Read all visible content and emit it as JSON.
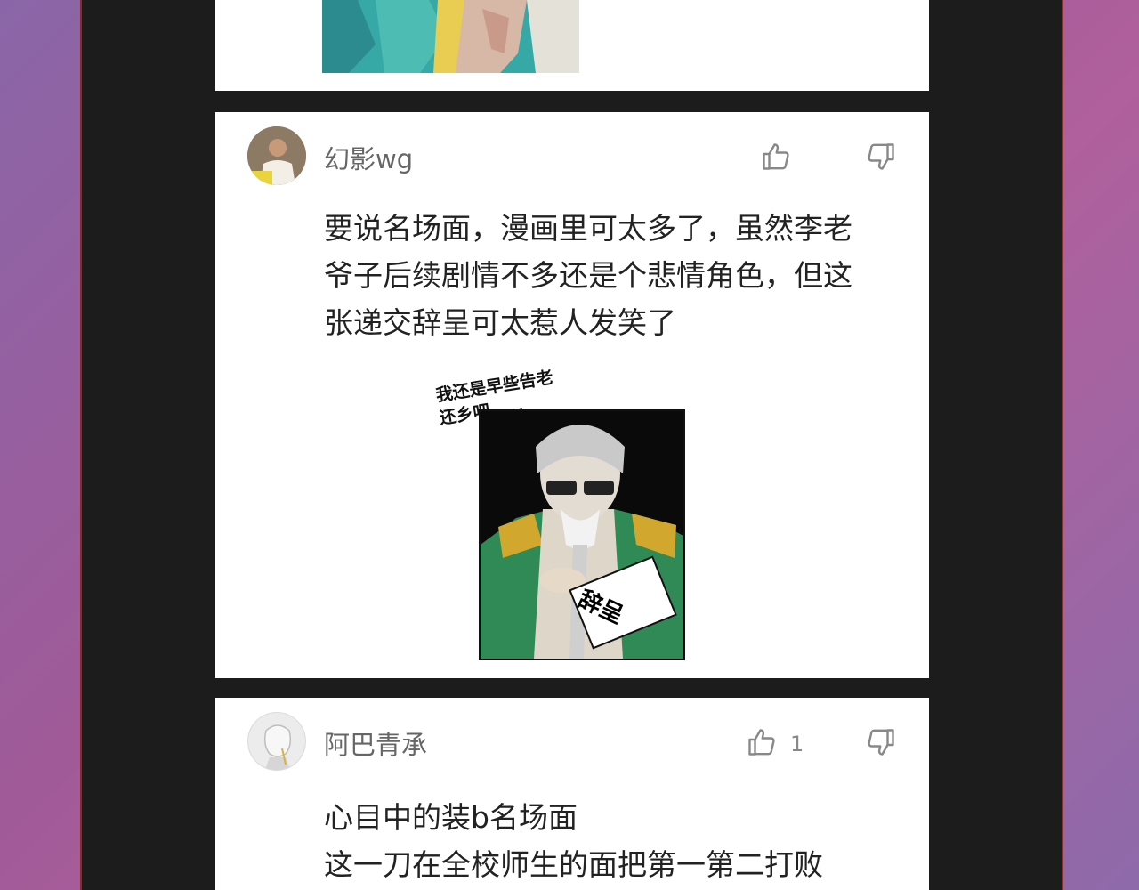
{
  "comments": [
    {
      "username": "幻影wg",
      "text": "要说名场面，漫画里可太多了，虽然李老\n爷子后续剧情不多还是个悲情角色，但这\n张递交辞呈可太惹人发笑了",
      "likes": "",
      "sticker": {
        "caption": "我还是早些告老\n还乡吧……",
        "sign_text": "辞呈"
      }
    },
    {
      "username": "阿巴青承",
      "text": "心目中的装b名场面\n这一刀在全校师生的面把第一第二打败",
      "likes": "1"
    }
  ],
  "icons": {
    "like": "thumbs-up-icon",
    "dislike": "thumbs-down-icon"
  }
}
